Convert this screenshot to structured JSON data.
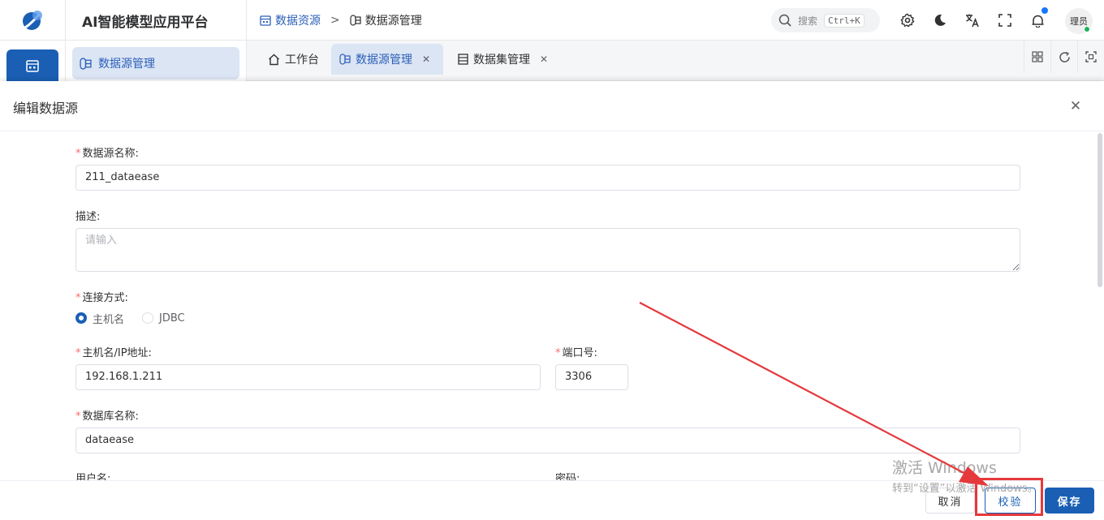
{
  "header": {
    "app_title": "AI智能模型应用平台",
    "breadcrumb": [
      "数据资源",
      "数据源管理"
    ],
    "search_placeholder": "搜索",
    "search_shortcut": "Ctrl+K",
    "user_label": "理员"
  },
  "sidebar": {
    "active_item": "数据源管理"
  },
  "tabs": [
    {
      "label": "工作台",
      "active": false,
      "closable": false
    },
    {
      "label": "数据源管理",
      "active": true,
      "closable": true
    },
    {
      "label": "数据集管理",
      "active": false,
      "closable": true
    }
  ],
  "modal": {
    "title": "编辑数据源",
    "fields": {
      "name_label": "数据源名称:",
      "name_value": "211_dataease",
      "desc_label": "描述:",
      "desc_placeholder": "请输入",
      "conn_label": "连接方式:",
      "conn_options": [
        "主机名",
        "JDBC"
      ],
      "conn_selected": "主机名",
      "host_label": "主机名/IP地址:",
      "host_value": "192.168.1.211",
      "port_label": "端口号:",
      "port_value": "3306",
      "db_label": "数据库名称:",
      "db_value": "dataease",
      "user_label": "用户名:",
      "pwd_label": "密码:"
    },
    "buttons": {
      "cancel": "取消",
      "verify": "校验",
      "save": "保存"
    }
  },
  "watermark": {
    "line1": "激活 Windows",
    "line2": "转到“设置”以激活 Windows。"
  },
  "colors": {
    "primary": "#1a5fb4",
    "annotation": "#e5393c"
  }
}
